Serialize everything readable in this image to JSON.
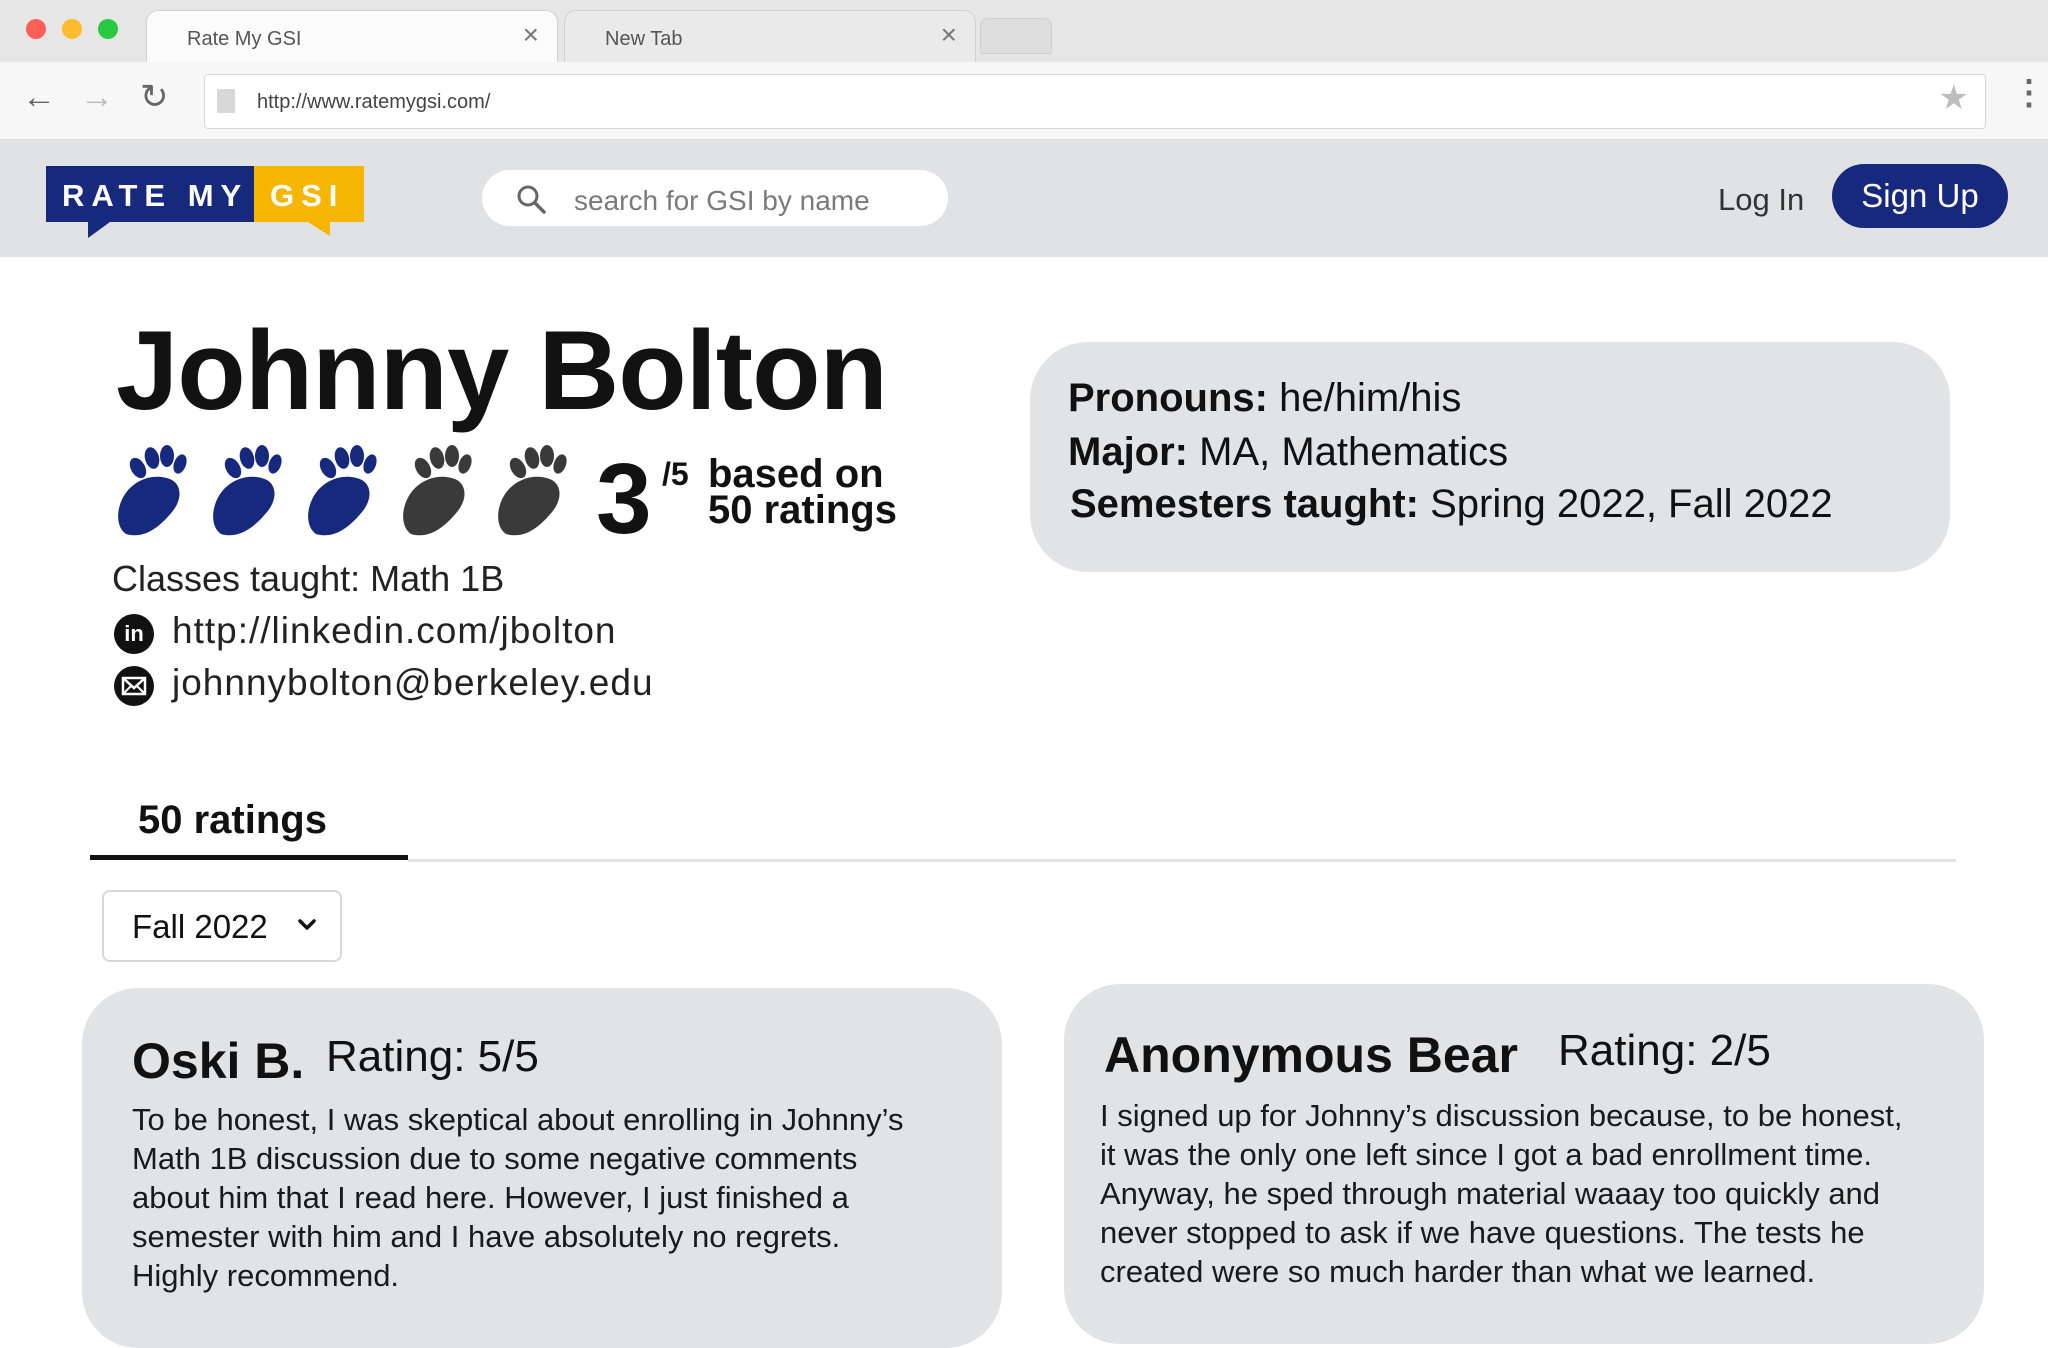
{
  "browser": {
    "tabs": [
      {
        "title": "Rate My GSI",
        "active": true
      },
      {
        "title": "New Tab",
        "active": false
      }
    ],
    "url": "http://www.ratemygsi.com/",
    "close_glyph": "×"
  },
  "header": {
    "logo_part1": "RATE MY",
    "logo_part2": "GSI",
    "search_placeholder": "search for GSI by name",
    "login_label": "Log In",
    "signup_label": "Sign Up"
  },
  "colors": {
    "brand_blue": "#17297c",
    "brand_gold": "#f6b600",
    "paw_filled": "#17297c",
    "paw_empty": "#3a3a3a"
  },
  "profile": {
    "name": "Johnny Bolton",
    "rating": "3",
    "rating_out_of": "/5",
    "rating_value": 3,
    "rating_max": 5,
    "based_on_line1": "based on",
    "based_on_line2": "50 ratings",
    "classes_taught": "Classes taught: Math 1B",
    "linkedin": "http://linkedin.com/jbolton",
    "linkedin_icon_text": "in",
    "email": "johnnybolton@berkeley.edu",
    "pronouns_label": "Pronouns:",
    "pronouns": "he/him/his",
    "major_label": "Major:",
    "major": "MA, Mathematics",
    "semesters_label": "Semesters taught:",
    "semesters": "Spring 2022, Fall 2022"
  },
  "ratings_section": {
    "tab_label": "50 ratings",
    "semester_filter": "Fall 2022"
  },
  "reviews": [
    {
      "author": "Oski B.",
      "rating": "Rating: 5/5",
      "lines": [
        "To be honest, I was skeptical about enrolling in Johnny’s",
        "Math 1B discussion due to some negative comments",
        "about him that I read here. However, I just finished a",
        "semester with him and I have absolutely no regrets.",
        "Highly recommend."
      ]
    },
    {
      "author": "Anonymous Bear",
      "rating": "Rating: 2/5",
      "lines": [
        "I signed up for Johnny’s discussion because, to be honest,",
        "it was the only one left since I got a bad enrollment time.",
        "Anyway, he sped through material waaay too quickly and",
        "never stopped to ask if we have questions. The tests he",
        "created were so much harder than what we learned."
      ]
    }
  ]
}
